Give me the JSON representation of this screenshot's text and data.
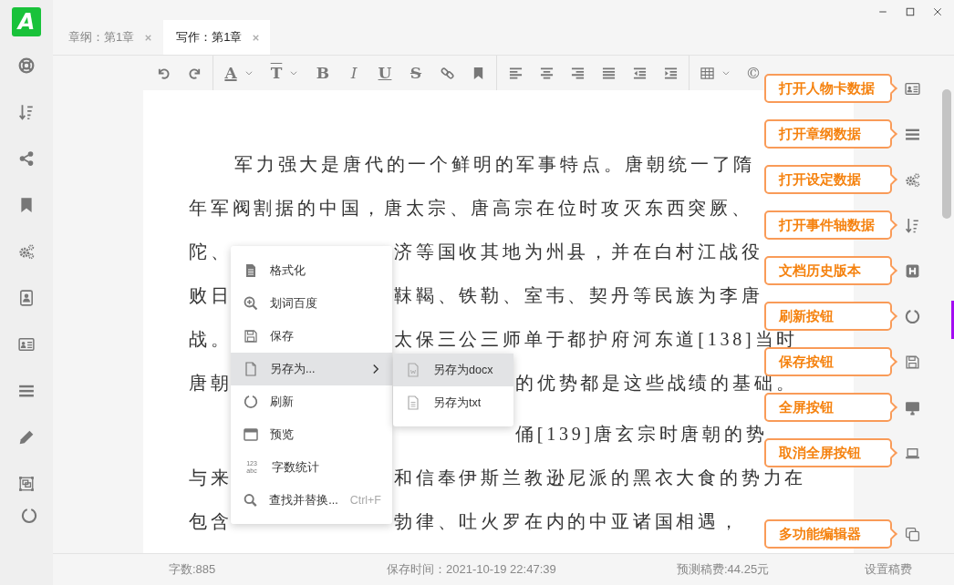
{
  "logo": {
    "glyph": "A"
  },
  "sidebar": {
    "items": [
      {
        "kind": "lifebuoy"
      },
      {
        "kind": "sort"
      },
      {
        "kind": "share"
      },
      {
        "kind": "bookmark"
      },
      {
        "kind": "gears"
      },
      {
        "kind": "contacts"
      },
      {
        "kind": "idcard"
      },
      {
        "kind": "list"
      },
      {
        "kind": "pencil"
      },
      {
        "kind": "frame"
      },
      {
        "kind": "refresh"
      }
    ]
  },
  "tabs": [
    {
      "label": "章纲：第1章",
      "selected": false
    },
    {
      "label": "写作：第1章",
      "selected": true
    }
  ],
  "toolbar": [
    {
      "kind": "undo"
    },
    {
      "kind": "redo"
    },
    {
      "kind": "separator"
    },
    {
      "kind": "font-color",
      "glyph": "A"
    },
    {
      "kind": "font-size",
      "glyph": "T"
    },
    {
      "kind": "bold",
      "glyph": "B"
    },
    {
      "kind": "italic",
      "glyph": "I"
    },
    {
      "kind": "underline",
      "glyph": "U"
    },
    {
      "kind": "strikethrough",
      "glyph": "S"
    },
    {
      "kind": "link"
    },
    {
      "kind": "bookmark"
    },
    {
      "kind": "separator"
    },
    {
      "kind": "align-left"
    },
    {
      "kind": "align-center"
    },
    {
      "kind": "align-right"
    },
    {
      "kind": "justify"
    },
    {
      "kind": "outdent"
    },
    {
      "kind": "indent"
    },
    {
      "kind": "separator"
    },
    {
      "kind": "table"
    },
    {
      "kind": "symbol",
      "glyph": "©"
    }
  ],
  "editor": {
    "paragraphs": [
      {
        "lines": [
          {
            "parts": [
              {
                "kind": "start",
                "text": "军力强大是唐代的一个鲜明的军事特点。唐朝统一了隋"
              }
            ]
          },
          {
            "parts": [
              {
                "kind": "start",
                "text": "年军阀割据的中国，唐太宗、唐高宗在位时攻灭东西突厥、"
              }
            ]
          },
          {
            "parts": [
              {
                "kind": "start",
                "text": "陀、"
              },
              {
                "kind": "end",
                "text": "济等国收其地为州县，并在白村江战役"
              }
            ]
          },
          {
            "parts": [
              {
                "kind": "start",
                "text": "败日"
              },
              {
                "kind": "end",
                "text": "靺鞨、铁勒、室韦、契丹等民族为李唐"
              }
            ]
          },
          {
            "parts": [
              {
                "kind": "start",
                "text": "战。"
              },
              {
                "kind": "end",
                "text": "太保三公三师单于都护府河东道[138]当时"
              }
            ]
          },
          {
            "parts": [
              {
                "kind": "start",
                "text": "唐朝"
              },
              {
                "kind": "end",
                "text": "的优势都是这些战绩的基础。"
              }
            ]
          }
        ]
      },
      {
        "lines": [
          {
            "parts": [
              {
                "kind": "end",
                "text": "俑[139]唐玄宗时唐朝的势"
              }
            ]
          },
          {
            "parts": [
              {
                "kind": "start",
                "text": "与来"
              },
              {
                "kind": "end",
                "text": "和信奉伊斯兰教逊尼派的黑衣大食的势力在"
              }
            ]
          },
          {
            "parts": [
              {
                "kind": "start",
                "text": "包含"
              },
              {
                "kind": "end",
                "text": "勃律、吐火罗在内的中亚诸国相遇，"
              }
            ]
          }
        ]
      }
    ]
  },
  "context_menu": {
    "items": [
      {
        "kind": "doc",
        "label": "格式化",
        "has_submenu": false,
        "selected": false
      },
      {
        "kind": "zoom",
        "label": "划词百度",
        "has_submenu": false,
        "selected": false
      },
      {
        "kind": "save",
        "label": "保存",
        "has_submenu": false,
        "selected": false
      },
      {
        "kind": "file",
        "label": "另存为...",
        "has_submenu": true,
        "selected": true
      },
      {
        "kind": "refresh",
        "label": "刷新",
        "has_submenu": false,
        "selected": false
      },
      {
        "kind": "preview",
        "label": "预览",
        "has_submenu": false,
        "selected": false
      },
      {
        "kind": "count",
        "label": "字数统计",
        "icon_text": [
          "123",
          "abc"
        ],
        "has_submenu": false,
        "selected": false
      },
      {
        "kind": "search",
        "label": "查找并替换...",
        "shortcut": "Ctrl+F",
        "has_submenu": false,
        "selected": false
      }
    ],
    "submenu": {
      "items": [
        {
          "kind": "word",
          "label": "另存为docx",
          "selected": true
        },
        {
          "kind": "txt",
          "label": "另存为txt",
          "selected": false
        }
      ]
    }
  },
  "right_toolbar": {
    "items": [
      {
        "kind": "idcard",
        "tooltip": "打开人物卡数据"
      },
      {
        "kind": "list",
        "tooltip": "打开章纲数据"
      },
      {
        "kind": "gears",
        "tooltip": "打开设定数据"
      },
      {
        "kind": "sort",
        "tooltip": "打开事件轴数据"
      },
      {
        "kind": "history",
        "tooltip": "文档历史版本"
      },
      {
        "kind": "refresh",
        "tooltip": "刷新按钮"
      },
      {
        "kind": "save",
        "tooltip": "保存按钮"
      },
      {
        "kind": "monitor",
        "tooltip": "全屏按钮"
      },
      {
        "kind": "laptop",
        "tooltip": "取消全屏按钮"
      }
    ],
    "bottom_items": [
      {
        "kind": "copy",
        "tooltip": "多功能编辑器"
      }
    ]
  },
  "status_bar": {
    "word_count": "字数:885",
    "save_time": "保存时间：2021-10-19 22:47:39",
    "estimated_fee": "预测稿费:44.25元",
    "fee_settings": "设置稿费"
  }
}
